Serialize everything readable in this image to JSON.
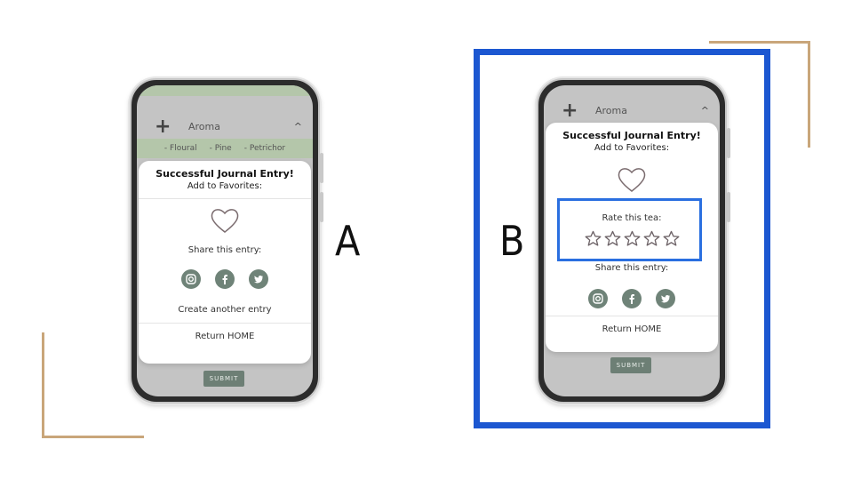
{
  "labels": {
    "a": "A",
    "b": "B"
  },
  "phone_a": {
    "aroma_label": "Aroma",
    "tags": [
      "- Floural",
      "- Pine",
      "- Petrichor"
    ],
    "modal_title": "Successful Journal Entry!",
    "modal_subtitle": "Add to Favorites:",
    "share_label": "Share this entry:",
    "create_another": "Create another entry",
    "return_home": "Return HOME",
    "submit_label": "SUBMIT"
  },
  "phone_b": {
    "aroma_label": "Aroma",
    "modal_title": "Successful Journal Entry!",
    "modal_subtitle": "Add to Favorites:",
    "rate_label": "Rate this tea:",
    "rating": {
      "value": 0,
      "max": 5
    },
    "share_label": "Share this entry:",
    "return_home": "Return HOME",
    "submit_label": "SUBMIT"
  },
  "colors": {
    "accent_blue": "#1c57d1",
    "social_green": "#6f8378",
    "corner_gold": "#c9a67a"
  },
  "icons": [
    "heart-icon",
    "instagram-icon",
    "facebook-icon",
    "twitter-icon",
    "star-icon",
    "plus-icon",
    "chevron-up-icon"
  ]
}
